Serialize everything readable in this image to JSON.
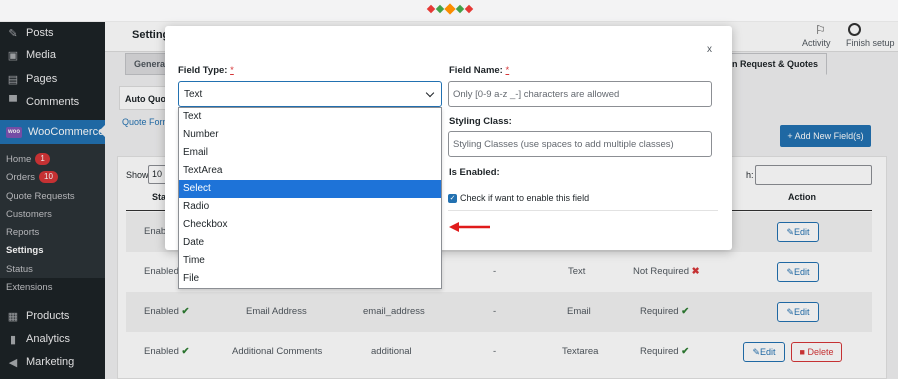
{
  "colors": {
    "sidebar": "#1d2327",
    "accent": "#2271b1",
    "highlight": "#1e73d8",
    "danger": "#d63638",
    "success": "#2e7d32"
  },
  "sidebar": {
    "posts": "Posts",
    "media": "Media",
    "pages": "Pages",
    "comments": "Comments",
    "woocommerce": "WooCommerce",
    "wc_logo": "woo",
    "sub": {
      "home": "Home",
      "home_badge": "1",
      "orders": "Orders",
      "orders_badge": "10",
      "quote_requests": "Quote Requests",
      "customers": "Customers",
      "reports": "Reports",
      "settings": "Settings",
      "status": "Status",
      "extensions": "Extensions"
    },
    "products": "Products",
    "analytics": "Analytics",
    "marketing": "Marketing"
  },
  "header": {
    "title": "Settings",
    "activity": "Activity",
    "finish_setup": "Finish setup"
  },
  "tabs": {
    "general": "General",
    "quotes": "n Request & Quotes"
  },
  "subtab": "Auto Quo",
  "quote_form_link": "Quote Form",
  "add_button": "+ Add New Field(s)",
  "table": {
    "show_label": "Show",
    "show_value": "10",
    "search_label": "h:",
    "headers": {
      "status": "Sta",
      "action": "Action"
    },
    "rows": [
      {
        "status": "Enabl",
        "label": "",
        "name": "",
        "dash": "",
        "type": "",
        "required": "",
        "edit": "Edit"
      },
      {
        "status": "Enabled",
        "label": "",
        "name": "",
        "dash": "-",
        "type": "Text",
        "required": "Not Required",
        "edit": "Edit"
      },
      {
        "status": "Enabled",
        "label": "Email Address",
        "name": "email_address",
        "dash": "-",
        "type": "Email",
        "required": "Required",
        "edit": "Edit"
      },
      {
        "status": "Enabled",
        "label": "Additional Comments",
        "name": "additional",
        "dash": "-",
        "type": "Textarea",
        "required": "Required",
        "edit": "Edit",
        "delete": "Delete"
      }
    ]
  },
  "modal": {
    "close": "x",
    "field_type_label": "Field Type:",
    "field_name_label": "Field Name:",
    "required_mark": "*",
    "selected_type": "Text",
    "field_name_placeholder": "Only [0-9 a-z _-] characters are allowed",
    "styling_class_label": "Styling Class:",
    "styling_class_placeholder": "Styling Classes (use spaces to add multiple classes)",
    "enabled_label": "Is Enabled:",
    "enabled_checkbox_text": "Check if want to enable this field"
  },
  "dropdown": {
    "options": [
      "Text",
      "Number",
      "Email",
      "TextArea",
      "Select",
      "Radio",
      "Checkbox",
      "Date",
      "Time",
      "File"
    ],
    "highlighted": "Select"
  }
}
